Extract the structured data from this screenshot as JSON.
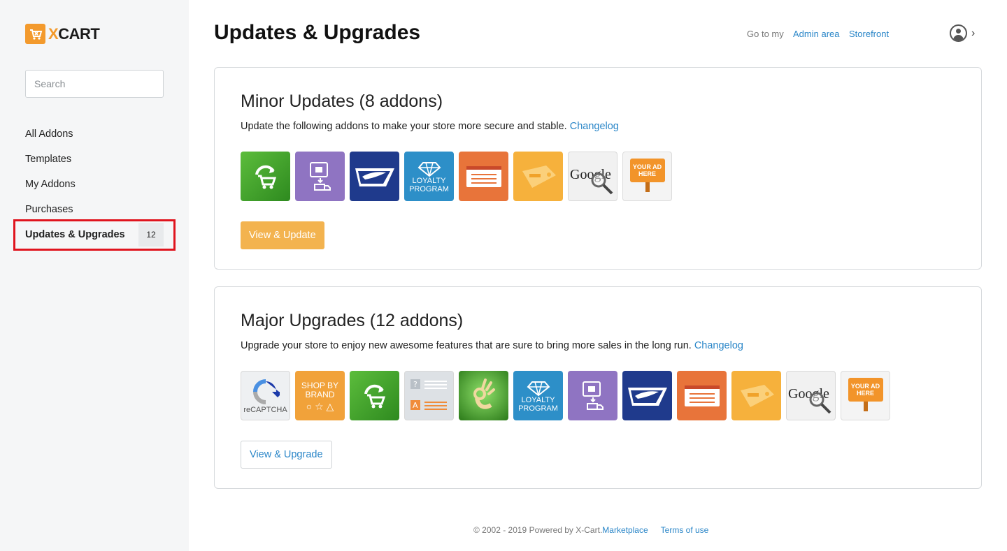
{
  "app": {
    "logo_text_x": "X",
    "logo_text_rest": "CART",
    "page_title": "Updates & Upgrades"
  },
  "header": {
    "goto_label": "Go to my",
    "admin_link": "Admin area",
    "storefront_link": "Storefront"
  },
  "sidebar": {
    "search_placeholder": "Search",
    "items": [
      {
        "label": "All Addons"
      },
      {
        "label": "Templates"
      },
      {
        "label": "My Addons"
      },
      {
        "label": "Purchases"
      },
      {
        "label": "Updates & Upgrades",
        "badge": "12",
        "active": true
      }
    ]
  },
  "minor": {
    "title": "Minor Updates (8 addons)",
    "description": "Update the following addons to make your store more secure and stable. ",
    "changelog_link": "Changelog",
    "button": "View & Update",
    "icons": [
      "cart-refresh-icon",
      "shipping-label-icon",
      "usps-eagle-icon",
      "loyalty-program-icon",
      "web-form-icon",
      "price-tag-icon",
      "google-search-icon",
      "your-ad-here-icon"
    ]
  },
  "major": {
    "title": "Major Upgrades (12 addons)",
    "description": "Upgrade your store to enjoy new awesome features that are sure to bring more sales in the long run. ",
    "changelog_link": "Changelog",
    "button": "View & Upgrade",
    "icons": [
      "recaptcha-icon",
      "shop-by-brand-icon",
      "cart-refresh-icon",
      "question-answer-icon",
      "ok-hand-icon",
      "loyalty-program-icon",
      "shipping-label-icon",
      "usps-eagle-icon",
      "web-form-icon",
      "price-tag-icon",
      "google-search-icon",
      "your-ad-here-icon"
    ]
  },
  "addon_text": {
    "loyalty": "LOYALTY PROGRAM",
    "your_ad": "YOUR AD HERE",
    "shop_by_brand": "SHOP BY BRAND",
    "brand_shapes": "○ ☆ △",
    "recaptcha": "reCAPTCHA",
    "google": "Google"
  },
  "footer": {
    "copyright": "© 2002 - 2019 Powered by X-Cart. ",
    "marketplace_link": "Marketplace",
    "terms_link": "Terms of use"
  },
  "colors": {
    "accent_orange": "#f39a2d",
    "link_blue": "#2a86c8",
    "highlight_red": "#e0141e",
    "primary_button": "#f3b34f"
  }
}
